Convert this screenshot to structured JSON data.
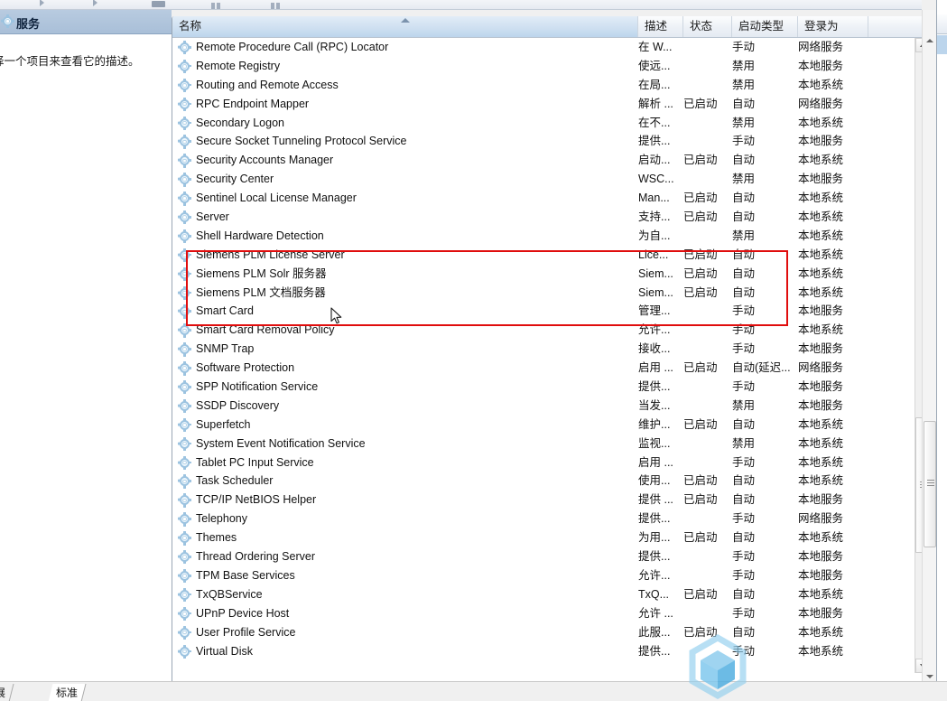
{
  "window": {
    "title": "服务",
    "left_pane_description": "择一个项目来查看它的描述。"
  },
  "toolbar": {
    "icons": [
      "forward-arrow-icon",
      "forward-arrow-icon",
      "window-icon",
      "columns-icon",
      "columns-icon"
    ]
  },
  "columns": [
    {
      "key": "name",
      "label": "名称",
      "sorted": true
    },
    {
      "key": "desc",
      "label": "描述",
      "sorted": false
    },
    {
      "key": "status",
      "label": "状态",
      "sorted": false
    },
    {
      "key": "startup",
      "label": "启动类型",
      "sorted": false
    },
    {
      "key": "logon",
      "label": "登录为",
      "sorted": false
    }
  ],
  "rows": [
    {
      "name": "Remote Procedure Call (RPC) Locator",
      "desc": "在 W...",
      "status": "",
      "startup": "手动",
      "logon": "网络服务"
    },
    {
      "name": "Remote Registry",
      "desc": "使远...",
      "status": "",
      "startup": "禁用",
      "logon": "本地服务"
    },
    {
      "name": "Routing and Remote Access",
      "desc": "在局...",
      "status": "",
      "startup": "禁用",
      "logon": "本地系统"
    },
    {
      "name": "RPC Endpoint Mapper",
      "desc": "解析 ...",
      "status": "已启动",
      "startup": "自动",
      "logon": "网络服务"
    },
    {
      "name": "Secondary Logon",
      "desc": "在不...",
      "status": "",
      "startup": "禁用",
      "logon": "本地系统"
    },
    {
      "name": "Secure Socket Tunneling Protocol Service",
      "desc": "提供...",
      "status": "",
      "startup": "手动",
      "logon": "本地服务"
    },
    {
      "name": "Security Accounts Manager",
      "desc": "启动...",
      "status": "已启动",
      "startup": "自动",
      "logon": "本地系统"
    },
    {
      "name": "Security Center",
      "desc": "WSC...",
      "status": "",
      "startup": "禁用",
      "logon": "本地服务"
    },
    {
      "name": "Sentinel Local License Manager",
      "desc": "Man...",
      "status": "已启动",
      "startup": "自动",
      "logon": "本地系统"
    },
    {
      "name": "Server",
      "desc": "支持...",
      "status": "已启动",
      "startup": "自动",
      "logon": "本地系统"
    },
    {
      "name": "Shell Hardware Detection",
      "desc": "为自...",
      "status": "",
      "startup": "禁用",
      "logon": "本地系统"
    },
    {
      "name": "Siemens PLM License Server",
      "desc": "Lice...",
      "status": "已启动",
      "startup": "自动",
      "logon": "本地系统"
    },
    {
      "name": "Siemens PLM Solr 服务器",
      "desc": "Siem...",
      "status": "已启动",
      "startup": "自动",
      "logon": "本地系统"
    },
    {
      "name": "Siemens PLM 文档服务器",
      "desc": "Siem...",
      "status": "已启动",
      "startup": "自动",
      "logon": "本地系统"
    },
    {
      "name": "Smart Card",
      "desc": "管理...",
      "status": "",
      "startup": "手动",
      "logon": "本地服务"
    },
    {
      "name": "Smart Card Removal Policy",
      "desc": "允许...",
      "status": "",
      "startup": "手动",
      "logon": "本地系统"
    },
    {
      "name": "SNMP Trap",
      "desc": "接收...",
      "status": "",
      "startup": "手动",
      "logon": "本地服务"
    },
    {
      "name": "Software Protection",
      "desc": "启用 ...",
      "status": "已启动",
      "startup": "自动(延迟...",
      "logon": "网络服务"
    },
    {
      "name": "SPP Notification Service",
      "desc": "提供...",
      "status": "",
      "startup": "手动",
      "logon": "本地服务"
    },
    {
      "name": "SSDP Discovery",
      "desc": "当发...",
      "status": "",
      "startup": "禁用",
      "logon": "本地服务"
    },
    {
      "name": "Superfetch",
      "desc": "维护...",
      "status": "已启动",
      "startup": "自动",
      "logon": "本地系统"
    },
    {
      "name": "System Event Notification Service",
      "desc": "监视...",
      "status": "",
      "startup": "禁用",
      "logon": "本地系统"
    },
    {
      "name": "Tablet PC Input Service",
      "desc": "启用 ...",
      "status": "",
      "startup": "手动",
      "logon": "本地系统"
    },
    {
      "name": "Task Scheduler",
      "desc": "使用...",
      "status": "已启动",
      "startup": "自动",
      "logon": "本地系统"
    },
    {
      "name": "TCP/IP NetBIOS Helper",
      "desc": "提供 ...",
      "status": "已启动",
      "startup": "自动",
      "logon": "本地服务"
    },
    {
      "name": "Telephony",
      "desc": "提供...",
      "status": "",
      "startup": "手动",
      "logon": "网络服务"
    },
    {
      "name": "Themes",
      "desc": "为用...",
      "status": "已启动",
      "startup": "自动",
      "logon": "本地系统"
    },
    {
      "name": "Thread Ordering Server",
      "desc": "提供...",
      "status": "",
      "startup": "手动",
      "logon": "本地服务"
    },
    {
      "name": "TPM Base Services",
      "desc": "允许...",
      "status": "",
      "startup": "手动",
      "logon": "本地服务"
    },
    {
      "name": "TxQBService",
      "desc": "TxQ...",
      "status": "已启动",
      "startup": "自动",
      "logon": "本地系统"
    },
    {
      "name": "UPnP Device Host",
      "desc": "允许 ...",
      "status": "",
      "startup": "手动",
      "logon": "本地服务"
    },
    {
      "name": "User Profile Service",
      "desc": "此服...",
      "status": "已启动",
      "startup": "自动",
      "logon": "本地系统"
    },
    {
      "name": "Virtual Disk",
      "desc": "提供...",
      "status": "",
      "startup": "手动",
      "logon": "本地系统"
    }
  ],
  "annotation": {
    "type": "red-rectangle",
    "highlighted_rows": [
      "Shell Hardware Detection",
      "Siemens PLM License Server",
      "Siemens PLM Solr 服务器",
      "Siemens PLM 文档服务器"
    ],
    "color": "#e00d0d"
  },
  "tabs": [
    {
      "label": "展",
      "active": false
    },
    {
      "label": "标准",
      "active": true
    }
  ],
  "colors": {
    "accent": "#bcd5ec",
    "header_gradient_top": "#fcfdfe",
    "annotation_red": "#e00d0d",
    "watermark_blue": "#59b3e6"
  },
  "watermark": {
    "name": "hexagon-cube-logo"
  }
}
